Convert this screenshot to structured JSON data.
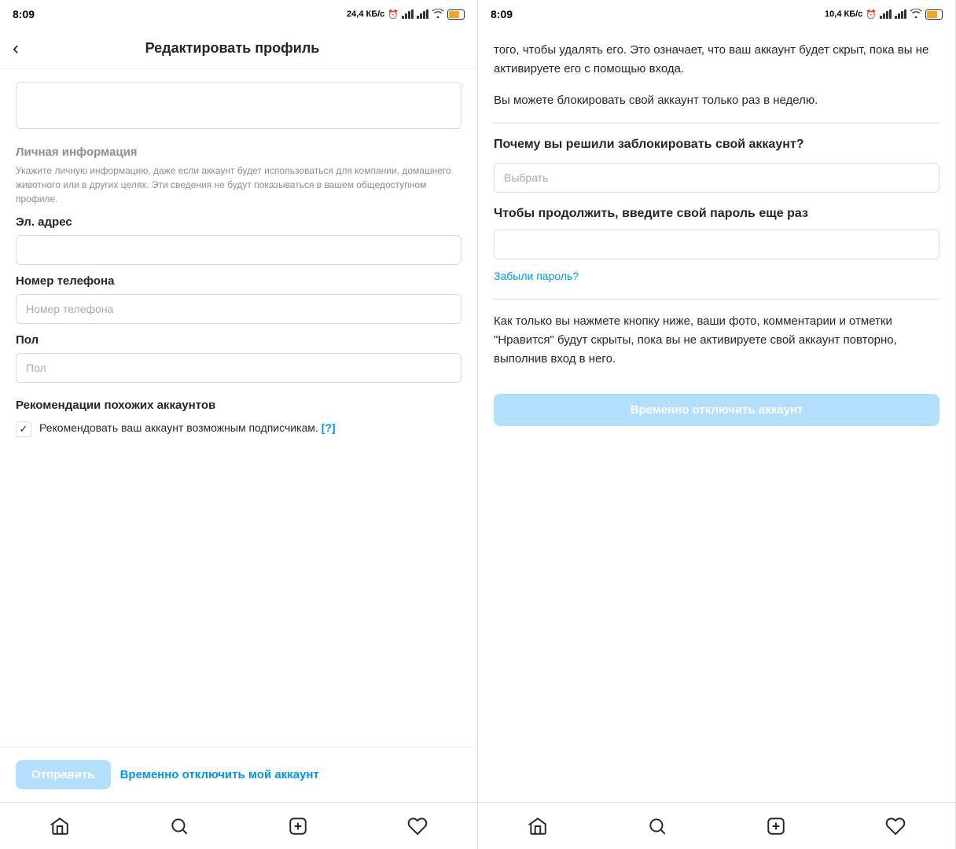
{
  "leftPanel": {
    "statusBar": {
      "time": "8:09",
      "speed": "24,4 КБ/с",
      "battery": "45"
    },
    "header": {
      "backLabel": "<",
      "title": "Редактировать профиль"
    },
    "personalInfo": {
      "sectionTitle": "Личная информация",
      "sectionDesc": "Укажите личную информацию, даже если аккаунт будет использоваться для компании, домашнего животного или в других целях. Эти сведения не будут показываться в вашем общедоступном профиле."
    },
    "emailField": {
      "label": "Эл. адрес",
      "placeholder": "",
      "value": ""
    },
    "phoneField": {
      "label": "Номер телефона",
      "placeholder": "Номер телефона",
      "value": ""
    },
    "genderField": {
      "label": "Пол",
      "placeholder": "Пол",
      "value": ""
    },
    "recommendations": {
      "title": "Рекомендации похожих аккаунтов",
      "checkboxLabel": "Рекомендовать ваш аккаунт возможным подписчикам.",
      "helpLabel": "[?]",
      "checked": true
    },
    "footer": {
      "submitLabel": "Отправить",
      "disableLabel": "Временно отключить мой аккаунт"
    },
    "nav": {
      "home": "home",
      "search": "search",
      "add": "add",
      "heart": "heart"
    }
  },
  "rightPanel": {
    "statusBar": {
      "time": "8:09",
      "speed": "10,4 КБ/с",
      "battery": "45"
    },
    "introText1": "того, чтобы удалять его. Это означает, что ваш аккаунт будет скрыт, пока вы не активируете его с помощью входа.",
    "introText2": "Вы можете блокировать свой аккаунт только раз в неделю.",
    "questionTitle": "Почему вы решили заблокировать свой аккаунт?",
    "selectPlaceholder": "Выбрать",
    "passwordTitle": "Чтобы продолжить, введите свой пароль еще раз",
    "passwordValue": "",
    "forgotPassword": "Забыли пароль?",
    "footerText": "Как только вы нажмете кнопку ниже, ваши фото, комментарии и отметки \"Нравится\" будут скрыты, пока вы не активируете свой аккаунт повторно, выполнив вход в него.",
    "disableButtonLabel": "Временно отключить аккаунт",
    "nav": {
      "home": "home",
      "search": "search",
      "add": "add",
      "heart": "heart"
    }
  }
}
